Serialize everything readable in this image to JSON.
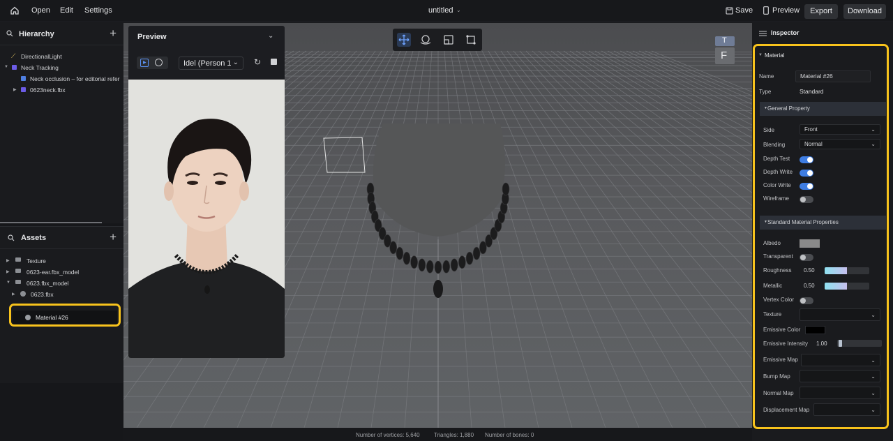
{
  "topbar": {
    "menu": [
      "Open",
      "Edit",
      "Settings"
    ],
    "title": "untitled",
    "save": "Save",
    "preview": "Preview",
    "export": "Export",
    "download": "Download"
  },
  "hierarchy": {
    "title": "Hierarchy",
    "items": [
      "DirectionalLight",
      "Neck Tracking",
      "Neck occlusion – for editorial refer",
      "0623neck.fbx"
    ]
  },
  "assets": {
    "title": "Assets",
    "items": [
      "Texture",
      "0623-ear.fbx_model",
      "0623.fbx_model",
      "0623.fbx",
      "Material #26"
    ]
  },
  "preview": {
    "title": "Preview",
    "animation": "Idel (Person 1)"
  },
  "viewport": {
    "axis_top": "T",
    "axis_front": "F"
  },
  "inspector": {
    "title": "Inspector",
    "material_section": "Material",
    "name_label": "Name",
    "name_value": "Material #26",
    "type_label": "Type",
    "type_value": "Standard",
    "general_section": "General Property",
    "side_label": "Side",
    "side_value": "Front",
    "blending_label": "Blending",
    "blending_value": "Normal",
    "depth_test_label": "Depth Test",
    "depth_test": true,
    "depth_write_label": "Depth Write",
    "depth_write": true,
    "color_write_label": "Color Write",
    "color_write": true,
    "wireframe_label": "Wireframe",
    "wireframe": false,
    "standard_section": "Standard Material Properties",
    "albedo_label": "Albedo",
    "albedo_color": "#8a8a8a",
    "transparent_label": "Transparent",
    "transparent": false,
    "roughness_label": "Roughness",
    "roughness_value": "0.50",
    "metallic_label": "Metallic",
    "metallic_value": "0.50",
    "vertex_color_label": "Vertex Color",
    "vertex_color": false,
    "texture_label": "Texture",
    "emissive_color_label": "Emissive Color",
    "emissive_color": "#000000",
    "emissive_intensity_label": "Emissive Intensity",
    "emissive_intensity_value": "1.00",
    "emissive_map_label": "Emissive Map",
    "bump_map_label": "Bump Map",
    "normal_map_label": "Normal Map",
    "displacement_map_label": "Displacement Map"
  },
  "status": {
    "vertices": "Number of vertices: 5,640",
    "triangles": "Triangles: 1,880",
    "bones": "Number of bones: 0"
  },
  "colors": {
    "accent": "#3e7de3",
    "highlight": "#f8c31c"
  }
}
